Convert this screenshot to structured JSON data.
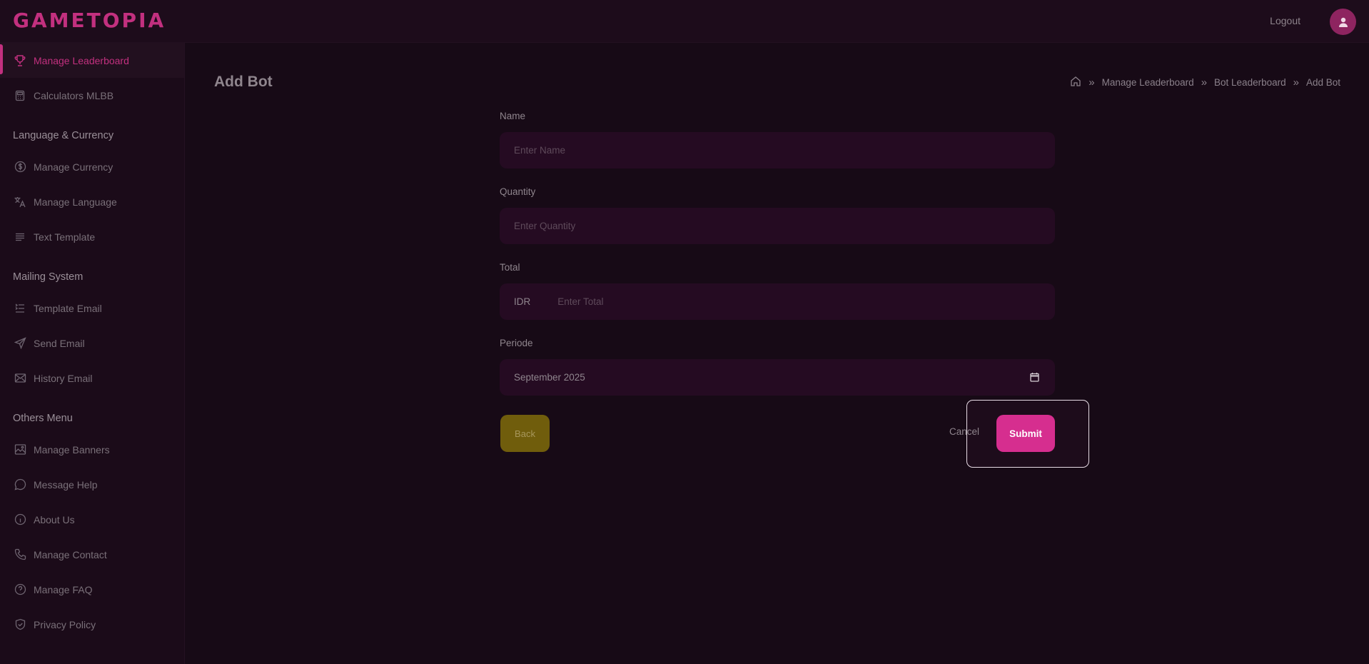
{
  "app": {
    "logo": "GAMETOPIA",
    "logout": "Logout"
  },
  "sidebar": {
    "items_top": [
      {
        "label": "Manage Leaderboard",
        "icon": "trophy-icon",
        "active": true
      },
      {
        "label": "Calculators MLBB",
        "icon": "calculator-icon"
      }
    ],
    "sections": [
      {
        "heading": "Language & Currency",
        "items": [
          {
            "label": "Manage Currency",
            "icon": "dollar-icon"
          },
          {
            "label": "Manage Language",
            "icon": "translate-icon"
          },
          {
            "label": "Text Template",
            "icon": "text-lines-icon"
          }
        ]
      },
      {
        "heading": "Mailing System",
        "items": [
          {
            "label": "Template Email",
            "icon": "list-indent-icon"
          },
          {
            "label": "Send Email",
            "icon": "send-icon"
          },
          {
            "label": "History Email",
            "icon": "mail-icon"
          }
        ]
      },
      {
        "heading": "Others Menu",
        "items": [
          {
            "label": "Manage Banners",
            "icon": "image-icon"
          },
          {
            "label": "Message Help",
            "icon": "chat-icon"
          },
          {
            "label": "About Us",
            "icon": "info-icon"
          },
          {
            "label": "Manage Contact",
            "icon": "phone-icon"
          },
          {
            "label": "Manage FAQ",
            "icon": "question-icon"
          },
          {
            "label": "Privacy Policy",
            "icon": "shield-icon"
          }
        ]
      }
    ]
  },
  "page": {
    "title": "Add Bot",
    "breadcrumb": [
      "Manage Leaderboard",
      "Bot Leaderboard",
      "Add Bot"
    ]
  },
  "form": {
    "name": {
      "label": "Name",
      "placeholder": "Enter Name",
      "value": ""
    },
    "quantity": {
      "label": "Quantity",
      "placeholder": "Enter Quantity",
      "value": ""
    },
    "total": {
      "label": "Total",
      "prefix": "IDR",
      "placeholder": "Enter Total",
      "value": ""
    },
    "periode": {
      "label": "Periode",
      "value": "September 2025"
    }
  },
  "buttons": {
    "back": "Back",
    "cancel": "Cancel",
    "submit": "Submit"
  },
  "colors": {
    "accent": "#d62e8f",
    "back": "#705d0c",
    "background": "#170a16"
  }
}
